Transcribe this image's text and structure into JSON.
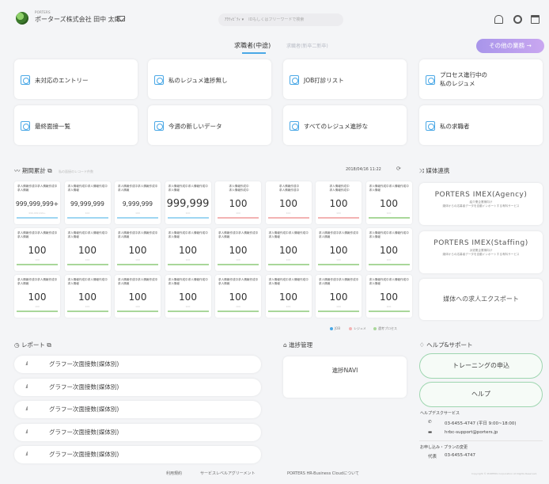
{
  "header": {
    "company_small": "PORTERS",
    "company": "ポーターズ株式会社  田中 太郎",
    "search_scope": "ｱｸﾃｨﾋﾞﾃｨ ▾",
    "search_placeholder": "IDもしくはフリーワードで検索"
  },
  "tabs": {
    "active": "求職者(中途)",
    "inactive": "求職者(新卒二新卒)",
    "other_button": "その他の業務  →"
  },
  "shortcuts": [
    "未対応のエントリー",
    "私のレジュメ進捗無し",
    "JOB打診リスト",
    "プロセス進行中の\n私のレジュメ",
    "最終面接一覧",
    "今週の新しいデータ",
    "すべてのレジュメ進捗な",
    "私の求職者"
  ],
  "stats": {
    "title": "期間累計",
    "subtitle": "私の面接のレコード件数",
    "timestamp": "2018/04/16 11:22",
    "rows": [
      [
        {
          "label": "求人情報作成中求人情報作成中求人情報",
          "value": "999,999,999+",
          "foot": "999,999,999+",
          "bar": "#9fd6f2",
          "style": "small"
        },
        {
          "label": "求人情報作成中求人情報作成中求人情報",
          "value": "99,999,999",
          "foot": "100",
          "bar": "#9fd6f2",
          "style": "small"
        },
        {
          "label": "求人情報作成中求人情報作成中求人情報",
          "value": "9,999,999",
          "foot": "100",
          "bar": "#9fd6f2",
          "style": "small"
        },
        {
          "label": "求人情報作成中求人情報作成中求人情報",
          "value": "999,999",
          "foot": "100",
          "bar": "#9fd6f2",
          "style": "big"
        },
        {
          "label": "求人情報作成中\n求人情報作成中",
          "value": "100",
          "foot": "100",
          "bar": "#f3b3b3",
          "style": "center"
        },
        {
          "label": "求人情報作成中\n求人情報作成中",
          "value": "100",
          "foot": "100",
          "bar": "#f3b3b3",
          "style": "center"
        },
        {
          "label": "求人情報作成中\n求人情報作成中",
          "value": "100",
          "foot": "100",
          "bar": "#f3b3b3",
          "style": "center"
        },
        {
          "label": "求人情報作成中求人情報作成中求人情報",
          "value": "100",
          "foot": "100",
          "bar": "#a9d79a",
          "style": "normal"
        }
      ],
      [
        {
          "label": "求人情報作成中求人情報作成中求人情報",
          "value": "100",
          "foot": "100",
          "bar": "#a9d79a",
          "style": "normal"
        },
        {
          "label": "求人情報作成中求人情報作成中求人情報",
          "value": "100",
          "foot": "100",
          "bar": "#a9d79a",
          "style": "normal"
        },
        {
          "label": "求人情報作成中求人情報作成中求人情報",
          "value": "100",
          "foot": "100",
          "bar": "#a9d79a",
          "style": "normal"
        },
        {
          "label": "求人情報作成中求人情報作成中求人情報",
          "value": "100",
          "foot": "100",
          "bar": "#a9d79a",
          "style": "normal"
        },
        {
          "label": "求人情報作成中求人情報作成中求人情報",
          "value": "100",
          "foot": "100",
          "bar": "#a9d79a",
          "style": "normal"
        },
        {
          "label": "求人情報作成中求人情報作成中求人情報",
          "value": "100",
          "foot": "100",
          "bar": "#a9d79a",
          "style": "normal"
        },
        {
          "label": "求人情報作成中求人情報作成中求人情報",
          "value": "100",
          "foot": "100",
          "bar": "#a9d79a",
          "style": "normal"
        },
        {
          "label": "求人情報作成中求人情報作成中求人情報",
          "value": "100",
          "foot": "100",
          "bar": "#a9d79a",
          "style": "normal"
        }
      ],
      [
        {
          "label": "求人情報作成中求人情報作成中求人情報",
          "value": "100",
          "foot": "100",
          "bar": "#a9d79a",
          "style": "normal"
        },
        {
          "label": "求人情報作成中求人情報作成中求人情報",
          "value": "100",
          "foot": "100",
          "bar": "#a9d79a",
          "style": "normal"
        },
        {
          "label": "求人情報作成中求人情報作成中求人情報",
          "value": "100",
          "foot": "100",
          "bar": "#a9d79a",
          "style": "normal"
        },
        {
          "label": "求人情報作成中求人情報作成中求人情報",
          "value": "100",
          "foot": "100",
          "bar": "#a9d79a",
          "style": "normal"
        },
        {
          "label": "求人情報作成中求人情報作成中求人情報",
          "value": "100",
          "foot": "100",
          "bar": "#a9d79a",
          "style": "normal"
        },
        {
          "label": "求人情報作成中求人情報作成中求人情報",
          "value": "100",
          "foot": "100",
          "bar": "#a9d79a",
          "style": "normal"
        },
        {
          "label": "求人情報作成中求人情報作成中求人情報",
          "value": "100",
          "foot": "100",
          "bar": "#a9d79a",
          "style": "normal"
        },
        {
          "label": "求人情報作成中求人情報作成中求人情報",
          "value": "100",
          "foot": "100",
          "bar": "#a9d79a",
          "style": "normal"
        }
      ]
    ],
    "legend": [
      {
        "label": "JOB",
        "color": "#4aa8e6"
      },
      {
        "label": "レジュメ",
        "color": "#f3b3b3"
      },
      {
        "label": "選考プロセス",
        "color": "#a9d79a"
      }
    ]
  },
  "media": {
    "title": "媒体連携",
    "cards": [
      {
        "title": "PORTERS IMEX(Agency)",
        "sub1": "紹介業企業様向け",
        "sub2": "媒体からの応募者データを自動インポートする有料サービス"
      },
      {
        "title": "PORTERS IMEX(Staffing)",
        "sub1": "派遣業企業様向け",
        "sub2": "媒体からの応募者データを自動インポートする有料サービス"
      },
      {
        "title": "媒体への求人エクスポート",
        "sub1": "",
        "sub2": ""
      }
    ]
  },
  "reports": {
    "title": "レポート",
    "items": [
      "グラフー次面接数(媒体別)",
      "グラフー次面接数(媒体別)",
      "グラフー次面接数(媒体別)",
      "グラフー次面接数(媒体別)",
      "グラフー次面接数(媒体別)"
    ]
  },
  "progress": {
    "title": "進捗管理",
    "navi": "進捗NAVI"
  },
  "help": {
    "title": "ヘルプ&サポート",
    "training": "トレーニングの申込",
    "help": "ヘルプ",
    "desk_label": "ヘルプデスクサービス",
    "phone": "03-6455-4747 (平日 9:00~18:00)",
    "email": "hrbc-support@porters.jp",
    "apply_label": "お申し込み・プランの変更",
    "rep_label": "代表",
    "rep_phone": "03-6455-4747"
  },
  "footer": {
    "terms": "利用規約",
    "sla": "サービスレベルアグリーメント",
    "about": "PORTERS HR-Business Cloudについて",
    "copyright": "Copyright © PORTERS Corporation All Rights Reserved."
  }
}
